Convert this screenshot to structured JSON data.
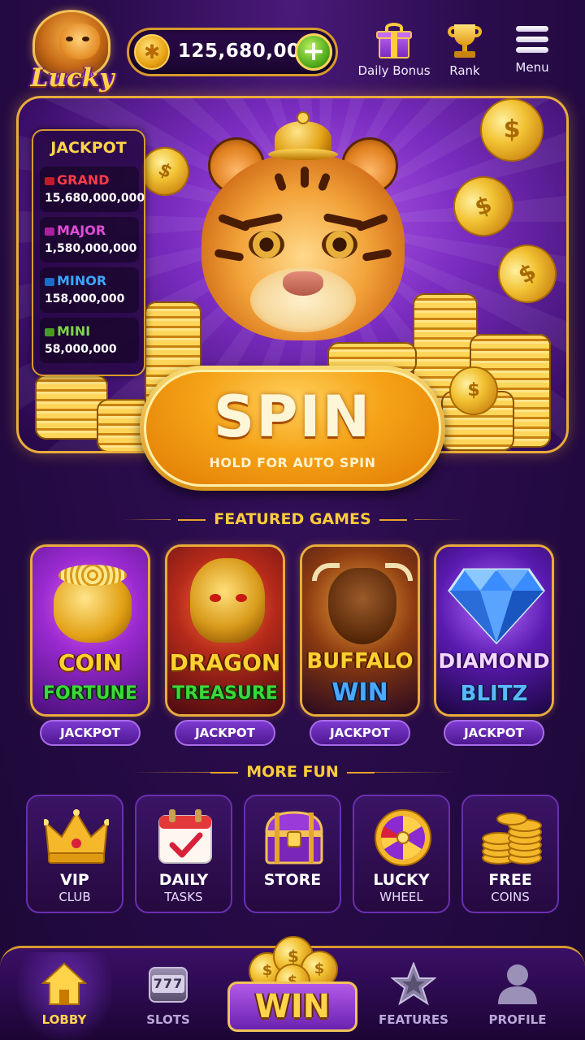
{
  "app": {
    "logo_text": "Lucky"
  },
  "header": {
    "coin_balance": "125,680,000",
    "actions": [
      {
        "label": "Daily Bonus",
        "icon": "gift-icon"
      },
      {
        "label": "Rank",
        "icon": "trophy-icon"
      },
      {
        "label": "Menu",
        "icon": "hamburger-menu-icon"
      }
    ]
  },
  "jackpot": {
    "title": "JACKPOT",
    "tiers": [
      {
        "name": "GRAND",
        "value": "15,680,000,000",
        "color": "#ff3b4a"
      },
      {
        "name": "MAJOR",
        "value": "1,580,000,000",
        "color": "#e24bd6"
      },
      {
        "name": "MINOR",
        "value": "158,000,000",
        "color": "#3ba6ff"
      },
      {
        "name": "MINI",
        "value": "58,000,000",
        "color": "#7bd64a"
      }
    ]
  },
  "spin": {
    "label": "SPIN",
    "sublabel": "HOLD FOR AUTO SPIN"
  },
  "featured": {
    "title": "FEATURED GAMES",
    "games": [
      {
        "line1": "COIN",
        "line2": "FORTUNE",
        "line2_color": "#3cd83a",
        "badge": "JACKPOT"
      },
      {
        "line1": "DRAGON",
        "line2": "TREASURE",
        "line2_color": "#3cd83a",
        "badge": "JACKPOT"
      },
      {
        "line1": "BUFFALO",
        "line2": "WIN",
        "line2_color": "#4aa8ff",
        "badge": "JACKPOT"
      },
      {
        "line1": "DIAMOND",
        "line2": "BLITZ",
        "line2_color": "#5ab8ff",
        "badge": "JACKPOT"
      }
    ]
  },
  "more_fun": {
    "title": "MORE FUN",
    "items": [
      {
        "line1": "VIP",
        "line2": "CLUB",
        "icon": "crown-icon"
      },
      {
        "line1": "DAILY",
        "line2": "TASKS",
        "icon": "calendar-check-icon"
      },
      {
        "line1": "STORE",
        "line2": "",
        "icon": "treasure-chest-icon"
      },
      {
        "line1": "LUCKY",
        "line2": "WHEEL",
        "icon": "fortune-wheel-icon"
      },
      {
        "line1": "FREE",
        "line2": "COINS",
        "icon": "coin-stack-icon"
      }
    ]
  },
  "bottom_nav": {
    "items": [
      {
        "label": "LOBBY",
        "icon": "house-icon",
        "active": true
      },
      {
        "label": "SLOTS",
        "icon": "slot-machine-icon",
        "active": false
      },
      {
        "label": "WIN",
        "icon": "coin-pile-icon",
        "active": false
      },
      {
        "label": "FEATURES",
        "icon": "star-icon",
        "active": false
      },
      {
        "label": "PROFILE",
        "icon": "user-icon",
        "active": false
      }
    ],
    "slots_reel_text": "777"
  },
  "colors": {
    "gold": "#ffd44a",
    "purple_bg": "#2a0c4c",
    "accent_border": "#e9ac3b"
  }
}
